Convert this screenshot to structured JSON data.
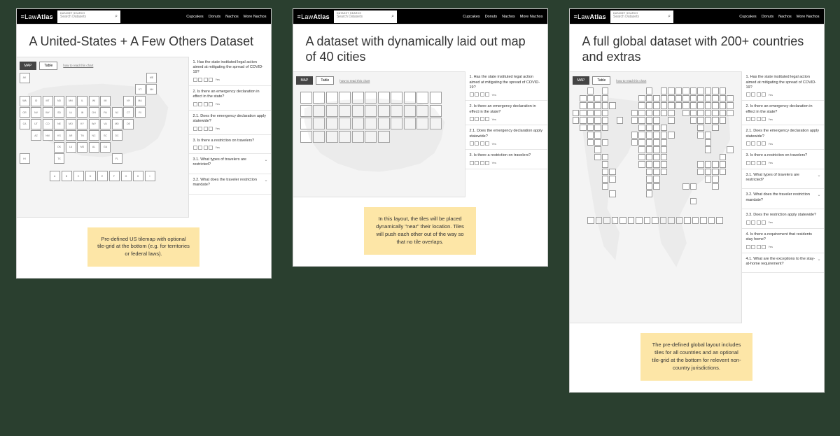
{
  "brand": {
    "prefix": "≡",
    "light": "Law",
    "bold": "Atlas"
  },
  "search": {
    "label": "DATASET SEARCH",
    "placeholder": "Search Datasets"
  },
  "nav": [
    "Cupcakes",
    "Donuts",
    "Nachos",
    "More Nachos"
  ],
  "tabs": {
    "map": "MAP",
    "table": "Table",
    "howto": "how to read this chart"
  },
  "yes": "Yes",
  "panel1": {
    "title": "A United-States + A Few Others Dataset",
    "note": "Pre-defined US tilemap with optional tile-grid at the bottom (e.g. for territories or federal laws).",
    "extras": [
      "A",
      "B",
      "C",
      "D",
      "E",
      "F",
      "G",
      "H",
      "I"
    ],
    "questions": [
      {
        "n": "1.",
        "t": "Has the state instituted legal action aimed at mitigating the spread of COVID-19?"
      },
      {
        "n": "2.",
        "t": "Is there an emergency declaration in effect in the state?"
      },
      {
        "n": "2.1.",
        "t": "Does the emergency declaration apply statewide?"
      },
      {
        "n": "3.",
        "t": "Is there a restriction on travelers?"
      },
      {
        "n": "3.1.",
        "t": "What types of travelers are restricted?",
        "sub": true
      },
      {
        "n": "3.2.",
        "t": "What does the traveler restriction mandate?",
        "sub": true
      }
    ]
  },
  "panel2": {
    "title": "A dataset with dynamically laid out map of 40 cities",
    "note": "In this layout, the tiles will be placed dynamically \"near\" their location. Tiles will push each other out of the way so that no tile overlaps.",
    "questions": [
      {
        "n": "1.",
        "t": "Has the state instituted legal action aimed at mitigating the spread of COVID-19?"
      },
      {
        "n": "2.",
        "t": "Is there an emergency declaration in effect in the state?"
      },
      {
        "n": "2.1.",
        "t": "Does the emergency declaration apply statewide?"
      },
      {
        "n": "3.",
        "t": "Is there a restriction on travelers?"
      }
    ]
  },
  "panel3": {
    "title": "A full global dataset with 200+ countries and extras",
    "note": "The pre-defined global layout includes tiles for all countries and an optional tile-grid at the bottom for relevent non-country jurisdictions.",
    "questions": [
      {
        "n": "1.",
        "t": "Has the state instituted legal action aimed at mitigating the spread of COVID-19?"
      },
      {
        "n": "2.",
        "t": "Is there an emergency declaration in effect in the state?"
      },
      {
        "n": "2.1.",
        "t": "Does the emergency declaration apply statewide?"
      },
      {
        "n": "3.",
        "t": "Is there a restriction on travelers?"
      },
      {
        "n": "3.1.",
        "t": "What types of travelers are restricted?",
        "sub": true
      },
      {
        "n": "3.2.",
        "t": "What does the traveler restriction mandate?",
        "sub": true
      },
      {
        "n": "3.3.",
        "t": "Does the restriction apply statewide?"
      },
      {
        "n": "4.",
        "t": "Is there a requirement that residents stay home?"
      },
      {
        "n": "4.1.",
        "t": "What are the exceptions to the stay-at-home requirement?",
        "sub": true
      }
    ]
  },
  "us_states": [
    [
      "AK",
      "",
      "",
      "",
      "",
      "",
      "",
      "",
      "",
      "",
      "",
      "ME"
    ],
    [
      "",
      "",
      "",
      "",
      "",
      "",
      "",
      "",
      "",
      "",
      "VT",
      "NH"
    ],
    [
      "WA",
      "ID",
      "MT",
      "ND",
      "MN",
      "IL",
      "WI",
      "MI",
      "",
      "NY",
      "MA",
      ""
    ],
    [
      "OR",
      "NV",
      "WY",
      "SD",
      "IA",
      "IN",
      "OH",
      "PA",
      "NJ",
      "CT",
      "RI",
      ""
    ],
    [
      "CA",
      "UT",
      "CO",
      "NE",
      "MO",
      "KY",
      "WV",
      "VA",
      "MD",
      "DE",
      "",
      ""
    ],
    [
      "",
      "AZ",
      "NM",
      "KS",
      "AR",
      "TN",
      "NC",
      "SC",
      "DC",
      "",
      "",
      ""
    ],
    [
      "",
      "",
      "",
      "OK",
      "LA",
      "MS",
      "AL",
      "GA",
      "",
      "",
      "",
      ""
    ],
    [
      "HI",
      "",
      "",
      "TX",
      "",
      "",
      "",
      "",
      "FL",
      "",
      "",
      ""
    ]
  ],
  "global_grid_cols": 22,
  "global_grid_pattern": [
    "..x.x.....x.xxxxxxxxx.",
    ".xxxx....xxxxxxxxxxxxx",
    ".xxxxx...xxxxxxxxxxxxx",
    "xxxxx...xxxxxx.xxxxxxx",
    "xxxxx.x.xxxx.x..xxxxx.",
    ".xxxx....xxxx....x.x..",
    "..xx....xxxxxx...xx...",
    "..xxx...xxxxx.....x...",
    "...x.....xxxx.....x..x",
    "...xx....xxxx.......x.",
    "....x....xxxx....xxxx.",
    "....xx....xxx....xxxx.",
    "....xx....xx......xx..",
    "....x.....xx...xx..x..",
    ".....x....x...........",
    "................x....."
  ],
  "global_extras": [
    "A",
    "B",
    "C",
    "D",
    "E",
    "F",
    "G",
    "H",
    "I",
    "J",
    "K",
    "L",
    "M",
    "N",
    "O",
    "P",
    "Q"
  ],
  "cities_count": 40
}
